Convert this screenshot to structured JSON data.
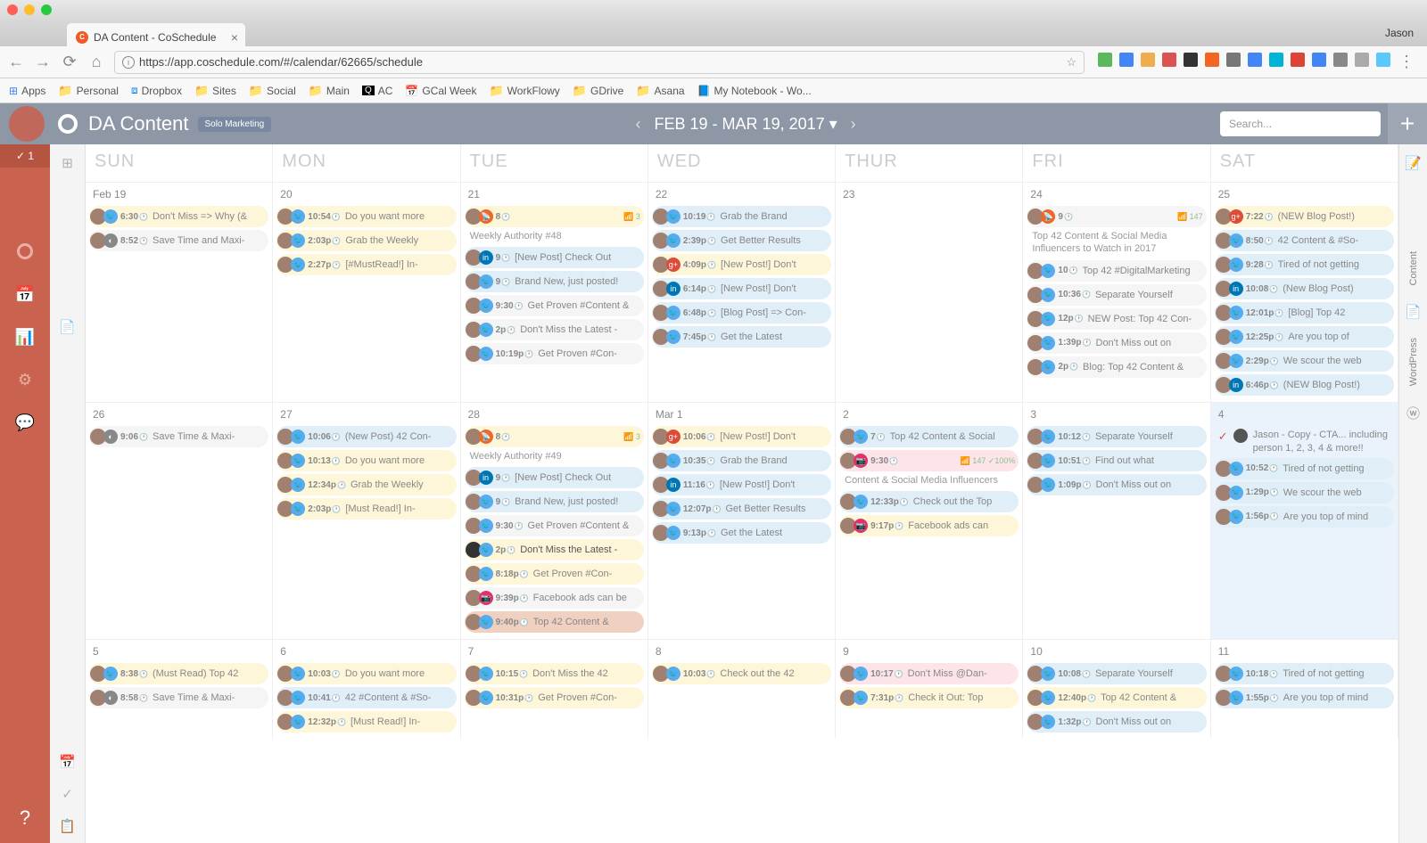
{
  "browser": {
    "tab_title": "DA Content - CoSchedule",
    "user": "Jason",
    "url": "https://app.coschedule.com/#/calendar/62665/schedule",
    "bookmarks": [
      "Apps",
      "Personal",
      "Dropbox",
      "Sites",
      "Social",
      "Main",
      "AC",
      "GCal Week",
      "WorkFlowy",
      "GDrive",
      "Asana",
      "My Notebook - Wo..."
    ]
  },
  "header": {
    "title": "DA Content",
    "badge": "Solo Marketing",
    "date_range": "FEB 19 - MAR 19, 2017",
    "search_placeholder": "Search..."
  },
  "sidebar_left": {
    "count": "✓ 1"
  },
  "day_headers": [
    "SUN",
    "MON",
    "TUE",
    "WED",
    "THUR",
    "FRI",
    "SAT"
  ],
  "weeks": [
    {
      "days": [
        {
          "label": "Feb 19",
          "events": [
            {
              "c": "yel",
              "soc": "tw",
              "time": "6:30",
              "txt": "Don't Miss => Why (&"
            },
            {
              "c": "white",
              "soc": "buf",
              "time": "8:52",
              "txt": "Save Time and Maxi-"
            }
          ]
        },
        {
          "label": "20",
          "events": [
            {
              "c": "yel",
              "soc": "tw",
              "time": "10:54",
              "txt": "Do you want more"
            },
            {
              "c": "yel",
              "soc": "tw",
              "time": "2:03p",
              "txt": "Grab the Weekly"
            },
            {
              "c": "yel",
              "soc": "tw",
              "time": "2:27p",
              "txt": "[#MustRead!] In-"
            }
          ]
        },
        {
          "label": "21",
          "events": [
            {
              "c": "yel",
              "soc": "rss",
              "time": "8",
              "txt": "",
              "bars": "📶 3",
              "line2": "Weekly Authority #48"
            },
            {
              "c": "blue",
              "soc": "in",
              "time": "9",
              "txt": "[New Post] Check Out"
            },
            {
              "c": "blue",
              "soc": "tw",
              "time": "9",
              "txt": "Brand New, just posted!"
            },
            {
              "c": "white",
              "soc": "tw",
              "time": "9:30",
              "txt": "Get Proven #Content &"
            },
            {
              "c": "white",
              "soc": "tw",
              "time": "2p",
              "txt": "Don't Miss the Latest -"
            },
            {
              "c": "white",
              "soc": "tw",
              "time": "10:19p",
              "txt": "Get Proven #Con-"
            }
          ]
        },
        {
          "label": "22",
          "events": [
            {
              "c": "blue",
              "soc": "tw",
              "time": "10:19",
              "txt": "Grab the Brand"
            },
            {
              "c": "blue",
              "soc": "tw",
              "time": "2:39p",
              "txt": "Get Better Results"
            },
            {
              "c": "yel",
              "soc": "gp",
              "time": "4:09p",
              "txt": "[New Post!] Don't"
            },
            {
              "c": "blue",
              "soc": "in",
              "time": "6:14p",
              "txt": "[New Post!] Don't"
            },
            {
              "c": "blue",
              "soc": "tw",
              "time": "6:48p",
              "txt": "[Blog Post] => Con-"
            },
            {
              "c": "blue",
              "soc": "tw",
              "time": "7:45p",
              "txt": "Get the Latest"
            }
          ]
        },
        {
          "label": "23",
          "events": []
        },
        {
          "label": "24",
          "events": [
            {
              "c": "white",
              "soc": "rss",
              "time": "9",
              "txt": "",
              "bars": "📶 147",
              "line2": "Top 42 Content & Social Media Influencers to Watch in 2017"
            },
            {
              "c": "white",
              "soc": "tw",
              "time": "10",
              "txt": "Top 42 #DigitalMarketing"
            },
            {
              "c": "white",
              "soc": "tw",
              "time": "10:36",
              "txt": "Separate Yourself"
            },
            {
              "c": "white",
              "soc": "tw",
              "time": "12p",
              "txt": "NEW Post: Top 42 Con-"
            },
            {
              "c": "white",
              "soc": "tw",
              "time": "1:39p",
              "txt": "Don't Miss out on"
            },
            {
              "c": "white",
              "soc": "tw",
              "time": "2p",
              "txt": "Blog: Top 42 Content &"
            }
          ]
        },
        {
          "label": "25",
          "events": [
            {
              "c": "yel",
              "soc": "gp",
              "time": "7:22",
              "txt": "(NEW Blog Post!)"
            },
            {
              "c": "blue",
              "soc": "tw",
              "time": "8:50",
              "txt": "42 Content & #So-"
            },
            {
              "c": "blue",
              "soc": "tw",
              "time": "9:28",
              "txt": "Tired of not getting"
            },
            {
              "c": "blue",
              "soc": "in",
              "time": "10:08",
              "txt": "(New Blog Post)"
            },
            {
              "c": "blue",
              "soc": "tw",
              "time": "12:01p",
              "txt": "[Blog] Top 42"
            },
            {
              "c": "blue",
              "soc": "tw",
              "time": "12:25p",
              "txt": "Are you top of"
            },
            {
              "c": "blue",
              "soc": "tw",
              "time": "2:29p",
              "txt": "We scour the web"
            },
            {
              "c": "blue",
              "soc": "in",
              "time": "6:46p",
              "txt": "(NEW Blog Post!)"
            }
          ]
        }
      ]
    },
    {
      "days": [
        {
          "label": "26",
          "events": [
            {
              "c": "white",
              "soc": "buf",
              "time": "9:06",
              "txt": "Save Time & Maxi-"
            }
          ]
        },
        {
          "label": "27",
          "events": [
            {
              "c": "blue",
              "soc": "tw",
              "time": "10:06",
              "txt": "(New Post) 42 Con-"
            },
            {
              "c": "yel",
              "soc": "tw",
              "time": "10:13",
              "txt": "Do you want more"
            },
            {
              "c": "yel",
              "soc": "tw",
              "time": "12:34p",
              "txt": "Grab the Weekly"
            },
            {
              "c": "yel",
              "soc": "tw",
              "time": "2:03p",
              "txt": "[Must Read!] In-"
            }
          ]
        },
        {
          "label": "28",
          "events": [
            {
              "c": "yel",
              "soc": "rss",
              "time": "8",
              "txt": "",
              "bars": "📶 3",
              "line2": "Weekly Authority #49"
            },
            {
              "c": "blue",
              "soc": "in",
              "time": "9",
              "txt": "[New Post] Check Out"
            },
            {
              "c": "blue",
              "soc": "tw",
              "time": "9",
              "txt": "Brand New, just posted!"
            },
            {
              "c": "white",
              "soc": "tw",
              "time": "9:30",
              "txt": "Get Proven #Content &"
            },
            {
              "c": "hl",
              "soc": "tw",
              "time": "2p",
              "txt": "Don't Miss the Latest -"
            },
            {
              "c": "yel",
              "soc": "tw",
              "time": "8:18p",
              "txt": "Get Proven #Con-"
            },
            {
              "c": "white",
              "soc": "ig",
              "time": "9:39p",
              "txt": "Facebook ads can be"
            },
            {
              "c": "draft",
              "soc": "tw",
              "time": "9:40p",
              "txt": "Top 42 Content &"
            }
          ]
        },
        {
          "label": "Mar 1",
          "events": [
            {
              "c": "yel",
              "soc": "gp",
              "time": "10:06",
              "txt": "[New Post!] Don't"
            },
            {
              "c": "blue",
              "soc": "tw",
              "time": "10:35",
              "txt": "Grab the Brand"
            },
            {
              "c": "blue",
              "soc": "in",
              "time": "11:16",
              "txt": "[New Post!] Don't"
            },
            {
              "c": "blue",
              "soc": "tw",
              "time": "12:07p",
              "txt": "Get Better Results"
            },
            {
              "c": "blue",
              "soc": "tw",
              "time": "9:13p",
              "txt": "Get the Latest"
            }
          ]
        },
        {
          "label": "2",
          "events": [
            {
              "c": "blue",
              "soc": "tw",
              "time": "7",
              "txt": "Top 42 Content & Social"
            },
            {
              "c": "pink",
              "soc": "ig",
              "time": "9:30",
              "txt": "",
              "bars": "📶 147 ✓100%",
              "line2": "Content & Social Media Influencers"
            },
            {
              "c": "blue",
              "soc": "tw",
              "time": "12:33p",
              "txt": "Check out the Top"
            },
            {
              "c": "yel",
              "soc": "ig",
              "time": "9:17p",
              "txt": "Facebook ads can"
            }
          ]
        },
        {
          "label": "3",
          "events": [
            {
              "c": "blue",
              "soc": "tw",
              "time": "10:12",
              "txt": "Separate Yourself"
            },
            {
              "c": "blue",
              "soc": "tw",
              "time": "10:51",
              "txt": "Find out what"
            },
            {
              "c": "blue",
              "soc": "tw",
              "time": "1:09p",
              "txt": "Don't Miss out on"
            }
          ]
        },
        {
          "label": "4",
          "today": true,
          "task": {
            "chk": "✓",
            "txt": "Jason - Copy - CTA... including person 1, 2, 3, 4 & more!!"
          },
          "events": [
            {
              "c": "blue",
              "soc": "tw",
              "time": "10:52",
              "txt": "Tired of not getting"
            },
            {
              "c": "blue",
              "soc": "tw",
              "time": "1:29p",
              "txt": "We scour the web"
            },
            {
              "c": "blue",
              "soc": "tw",
              "time": "1:56p",
              "txt": "Are you top of mind"
            }
          ]
        }
      ]
    },
    {
      "short": true,
      "days": [
        {
          "label": "5",
          "events": [
            {
              "c": "yel",
              "soc": "tw",
              "time": "8:38",
              "txt": "(Must Read) Top 42"
            },
            {
              "c": "white",
              "soc": "buf",
              "time": "8:58",
              "txt": "Save Time & Maxi-"
            }
          ]
        },
        {
          "label": "6",
          "events": [
            {
              "c": "yel",
              "soc": "tw",
              "time": "10:03",
              "txt": "Do you want more"
            },
            {
              "c": "blue",
              "soc": "tw",
              "time": "10:41",
              "txt": "42 #Content & #So-"
            },
            {
              "c": "yel",
              "soc": "tw",
              "time": "12:32p",
              "txt": "[Must Read!] In-"
            }
          ]
        },
        {
          "label": "7",
          "events": [
            {
              "c": "yel",
              "soc": "tw",
              "time": "10:15",
              "txt": "Don't Miss the 42"
            },
            {
              "c": "yel",
              "soc": "tw",
              "time": "10:31p",
              "txt": "Get Proven #Con-"
            }
          ]
        },
        {
          "label": "8",
          "events": [
            {
              "c": "yel",
              "soc": "tw",
              "time": "10:03",
              "txt": "Check out the 42"
            }
          ]
        },
        {
          "label": "9",
          "events": [
            {
              "c": "pink",
              "soc": "tw",
              "time": "10:17",
              "txt": "Don't Miss @Dan-"
            },
            {
              "c": "yel",
              "soc": "tw",
              "time": "7:31p",
              "txt": "Check it Out: Top"
            }
          ]
        },
        {
          "label": "10",
          "events": [
            {
              "c": "blue",
              "soc": "tw",
              "time": "10:08",
              "txt": "Separate Yourself"
            },
            {
              "c": "yel",
              "soc": "tw",
              "time": "12:40p",
              "txt": "Top 42 Content &"
            },
            {
              "c": "blue",
              "soc": "tw",
              "time": "1:32p",
              "txt": "Don't Miss out on"
            }
          ]
        },
        {
          "label": "11",
          "events": [
            {
              "c": "blue",
              "soc": "tw",
              "time": "10:18",
              "txt": "Tired of not getting"
            },
            {
              "c": "blue",
              "soc": "tw",
              "time": "1:55p",
              "txt": "Are you top of mind"
            }
          ]
        }
      ]
    }
  ],
  "right_rail": {
    "labels": [
      "Content",
      "WordPress"
    ]
  }
}
